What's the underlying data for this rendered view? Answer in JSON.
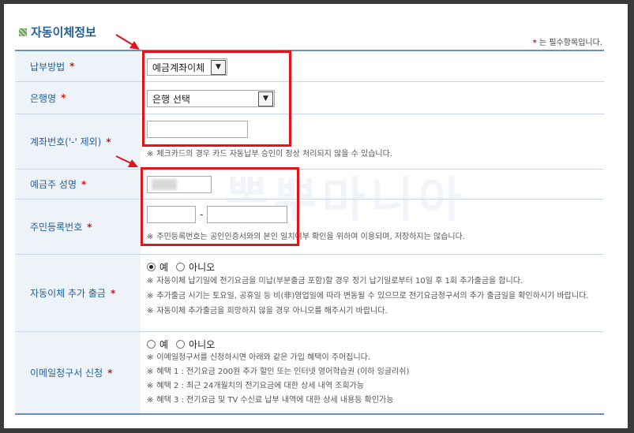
{
  "title": "자동이체정보",
  "required_note": "는 필수항목입니다.",
  "required_mark": "*",
  "watermark_text": "뽐뿌마니아",
  "rows": {
    "payment_method": {
      "label": "납부방법",
      "selected": "예금계좌이체"
    },
    "bank_name": {
      "label": "은행명",
      "selected": "은행 선택"
    },
    "account_no": {
      "label": "계좌번호('-' 제외)",
      "note": "체크카드의 경우 카드 자동납부 승인이 정상 처리되지 않을 수 있습니다."
    },
    "holder_name": {
      "label": "예금주 성명"
    },
    "resident_no": {
      "label": "주민등록번호",
      "dash": "-",
      "note": "주민등록번호는 공인인증서와의 본인 일치여부 확인을 위하여 이용되며, 저장하지는 않습니다."
    },
    "extra_withdraw": {
      "label": "자동이체 추가 출금",
      "yes": "예",
      "no": "아니오",
      "selected": "yes",
      "notes": [
        "자동이체 납기일에 전기요금을 미납(부분출금 포함)할 경우 정기 납기일로부터 10일 후 1회 추가출금을 합니다.",
        "추가출금 시기는 토요일, 공휴일 등 비(非)영업일에 따라 변동될 수 있으므로 전기요금청구서의 추가 출금일을 확인하시기 바랍니다.",
        "자동이체 추가출금을 희망하지 않을 경우 아니오를 해주시기 바랍니다."
      ]
    },
    "email_bill": {
      "label": "이메일청구서 신청",
      "yes": "예",
      "no": "아니오",
      "selected": "none",
      "notes": [
        "이메일청구서를 신청하시면 아래와 같은 가입 혜택이 주어집니다.",
        "혜택 1 : 전기요금 200원 추가 할인 또는 인터넷 영어학습권 (이하 잉글리쉬)",
        "혜택 2 : 최근 24개월치의 전기요금에 대한 상세 내역 조회가능",
        "혜택 3 : 전기요금 및 TV 수신료 납부 내역에 대한 상세 내용등 확인가능"
      ]
    }
  },
  "note_mark": "※",
  "colors": {
    "accent": "#1f5f9e",
    "highlight": "#e0141a",
    "label_bg": "#eef3f9"
  }
}
